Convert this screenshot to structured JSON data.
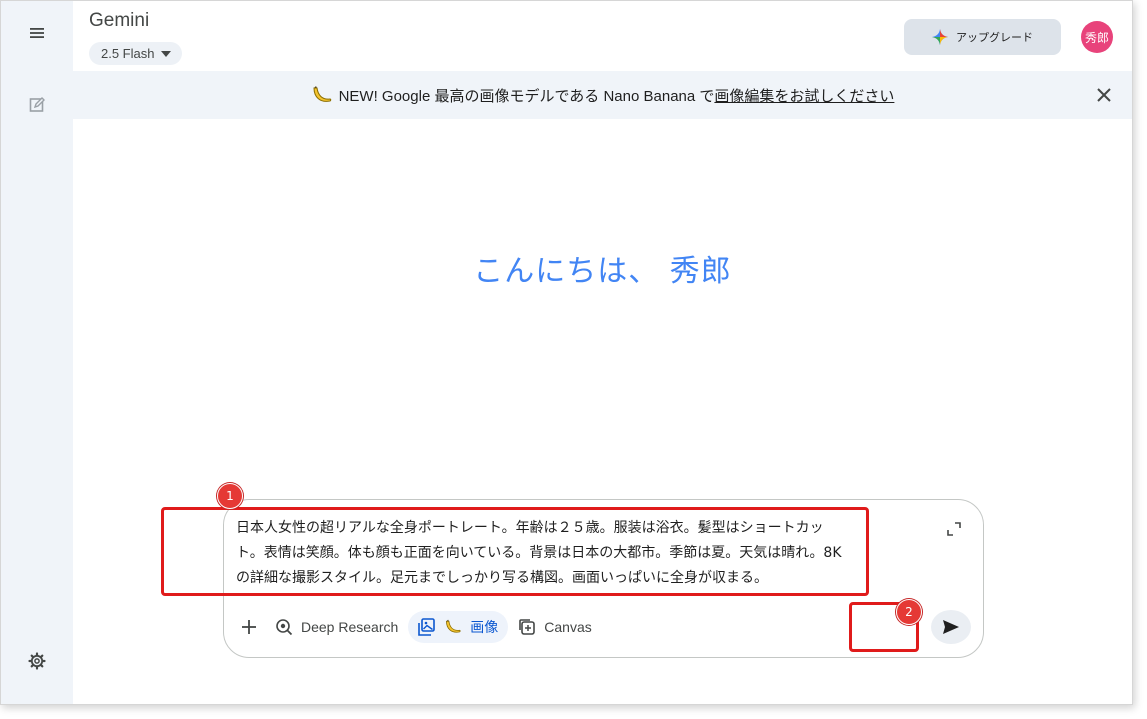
{
  "app": {
    "title": "Gemini",
    "model": "2.5 Flash",
    "upgrade_label": "アップグレード",
    "avatar_text": "秀郎"
  },
  "banner": {
    "prefix": "NEW! Google 最高の画像モデルである Nano Banana で",
    "link": "画像編集をお試しください"
  },
  "greeting": "こんにちは、 秀郎",
  "prompt": {
    "lines": [
      "日本人女性の超リアルな全身ポートレート。年齢は２５歳。服装は浴衣。髪型はショートカッ",
      "ト。表情は笑顔。体も顔も正面を向いている。背景は日本の大都市。季節は夏。天気は晴れ。8K",
      "の詳細な撮影スタイル。足元までしっかり写る構図。画面いっぱいに全身が収まる。"
    ]
  },
  "toolbar": {
    "deep_research": "Deep Research",
    "image": "画像",
    "canvas": "Canvas"
  },
  "annotations": {
    "badge1": "1",
    "badge2": "2",
    "color": "#e01b1b"
  },
  "colors": {
    "accent": "#4285f4",
    "sidebar": "#f0f4f9",
    "avatar": "#e8437b"
  },
  "icons": [
    "menu-icon",
    "new-chat-icon",
    "settings-icon",
    "chevron-down-icon",
    "gemini-star-icon",
    "banana-icon",
    "close-icon",
    "expand-icon",
    "plus-icon",
    "deep-research-icon",
    "image-icon",
    "canvas-icon",
    "send-icon"
  ]
}
